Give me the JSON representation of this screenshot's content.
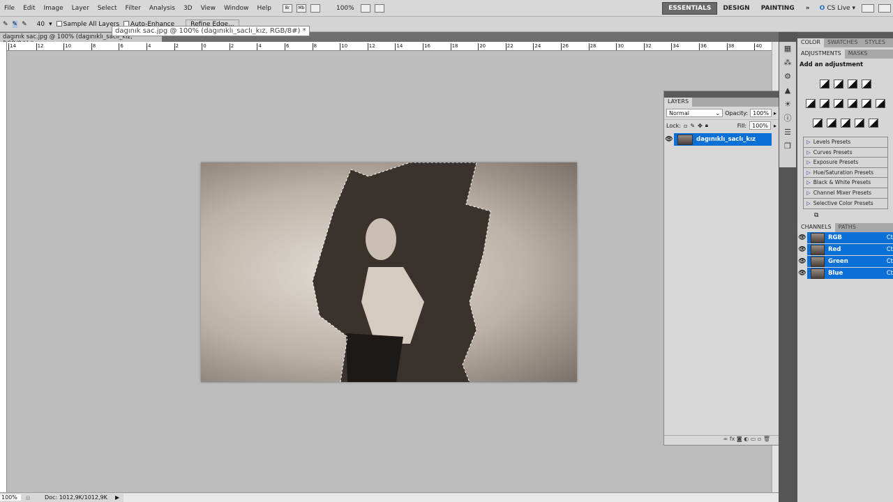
{
  "menu": [
    "File",
    "Edit",
    "Image",
    "Layer",
    "Select",
    "Filter",
    "Analysis",
    "3D",
    "View",
    "Window",
    "Help"
  ],
  "appbar": {
    "br": "Br",
    "mb": "Mb",
    "zoom": "100%"
  },
  "workspaces": [
    "ESSENTIALS",
    "DESIGN",
    "PAINTING"
  ],
  "cslive": "CS Live",
  "options": {
    "brush_size": "40",
    "sample_all": "Sample All Layers",
    "auto_enhance": "Auto-Enhance",
    "refine_edge": "Refine Edge..."
  },
  "document": {
    "tab_title": "dagınık sac.jpg @ 100% (dagınıklı_saclı_kız, RGB/8#) *",
    "tooltip": "dagınık sac.jpg @ 100% (dagınıklı_saclı_kız, RGB/8#) *"
  },
  "ruler_ticks": [
    "14",
    "12",
    "10",
    "8",
    "6",
    "4",
    "2",
    "0",
    "2",
    "4",
    "6",
    "8",
    "10",
    "12",
    "14",
    "16",
    "18",
    "20",
    "22",
    "24",
    "26",
    "28",
    "30",
    "32",
    "34",
    "36",
    "38",
    "40"
  ],
  "status": {
    "zoom": "100%",
    "doc": "Doc: 1012,9K/1012,9K"
  },
  "layers": {
    "title": "LAYERS",
    "blend": "Normal",
    "opacity_label": "Opacity:",
    "opacity": "100%",
    "lock_label": "Lock:",
    "fill_label": "Fill:",
    "fill": "100%",
    "items": [
      {
        "name": "dagınıklı_saclı_kız"
      }
    ]
  },
  "right": {
    "tabs1": [
      "COLOR",
      "SWATCHES",
      "STYLES"
    ],
    "tabs2": [
      "ADJUSTMENTS",
      "MASKS"
    ],
    "add_adjustment": "Add an adjustment",
    "presets": [
      "Levels Presets",
      "Curves Presets",
      "Exposure Presets",
      "Hue/Saturation Presets",
      "Black & White Presets",
      "Channel Mixer Presets",
      "Selective Color Presets"
    ],
    "tabs3": [
      "CHANNELS",
      "PATHS"
    ],
    "channels": [
      {
        "name": "RGB",
        "shortcut": "Ct"
      },
      {
        "name": "Red",
        "shortcut": "Ct"
      },
      {
        "name": "Green",
        "shortcut": "Ct"
      },
      {
        "name": "Blue",
        "shortcut": "Ct"
      }
    ]
  }
}
